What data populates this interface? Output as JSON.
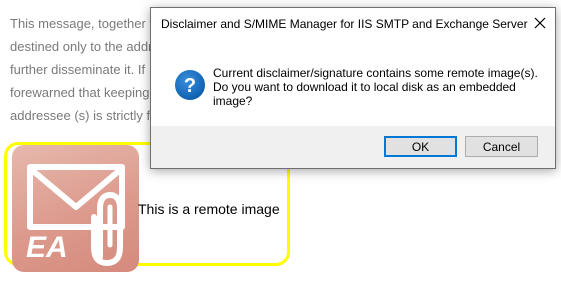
{
  "background_doc": {
    "lines": [
      "This message, together v",
      "destined only to the addr",
      "further disseminate it. If",
      "forewarned that keeping",
      "addressee (s) is strictly fo"
    ],
    "remote_image_caption": "This is a remote image",
    "logo_text": "EA",
    "highlight_color": "#ffff00"
  },
  "dialog": {
    "title": "Disclaimer and S/MIME Manager for IIS SMTP and Exchange Server",
    "close_glyph": "✕",
    "icon": "question-icon",
    "message_lines": [
      "Current disclaimer/signature contains some remote image(s).",
      "Do you want to download it to local disk as an embedded",
      "image?"
    ],
    "ok_label": "OK",
    "cancel_label": "Cancel",
    "accent_color": "#0078d7"
  }
}
